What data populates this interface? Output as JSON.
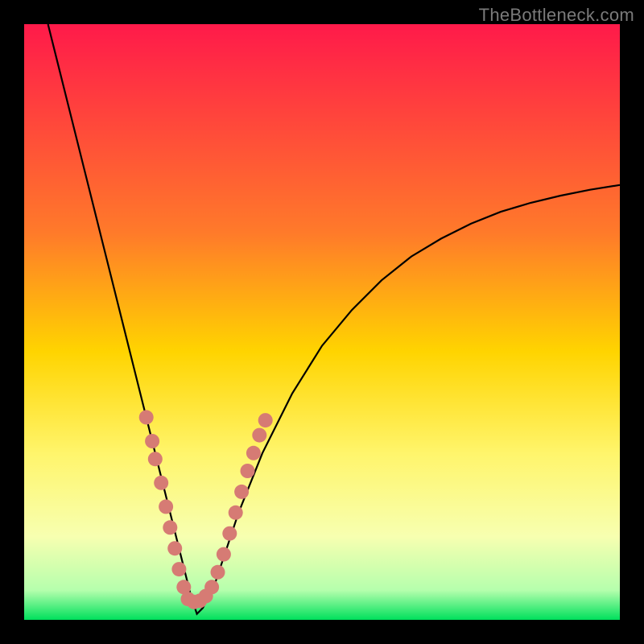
{
  "watermark": "TheBottleneck.com",
  "chart_data": {
    "type": "line",
    "title": "",
    "xlabel": "",
    "ylabel": "",
    "xlim": [
      0,
      100
    ],
    "ylim": [
      0,
      100
    ],
    "gradient_stops": [
      {
        "offset": 0,
        "color": "#ff1a4a"
      },
      {
        "offset": 35,
        "color": "#ff7a2a"
      },
      {
        "offset": 55,
        "color": "#ffd400"
      },
      {
        "offset": 72,
        "color": "#fff56b"
      },
      {
        "offset": 86,
        "color": "#f7ffb0"
      },
      {
        "offset": 95,
        "color": "#b6ffad"
      },
      {
        "offset": 100,
        "color": "#00e05c"
      }
    ],
    "series": [
      {
        "name": "bottleneck-curve",
        "x": [
          4,
          6,
          8,
          10,
          12,
          14,
          16,
          18,
          20,
          22,
          24,
          26,
          27,
          28,
          29,
          30,
          32,
          34,
          36,
          40,
          45,
          50,
          55,
          60,
          65,
          70,
          75,
          80,
          85,
          90,
          95,
          100
        ],
        "values": [
          100,
          92,
          84,
          76,
          68,
          60,
          52,
          44,
          36,
          28,
          20,
          12,
          8,
          4,
          1,
          2,
          6,
          12,
          18,
          28,
          38,
          46,
          52,
          57,
          61,
          64,
          66.5,
          68.5,
          70,
          71.2,
          72.2,
          73
        ]
      }
    ],
    "marker_points": {
      "left_branch": [
        {
          "x": 20.5,
          "y": 34
        },
        {
          "x": 21.5,
          "y": 30
        },
        {
          "x": 22.0,
          "y": 27
        },
        {
          "x": 23.0,
          "y": 23
        },
        {
          "x": 23.8,
          "y": 19
        },
        {
          "x": 24.5,
          "y": 15.5
        },
        {
          "x": 25.3,
          "y": 12
        },
        {
          "x": 26.0,
          "y": 8.5
        },
        {
          "x": 26.8,
          "y": 5.5
        }
      ],
      "bottom": [
        {
          "x": 27.5,
          "y": 3.5
        },
        {
          "x": 28.5,
          "y": 3.0
        },
        {
          "x": 29.5,
          "y": 3.2
        },
        {
          "x": 30.5,
          "y": 4.0
        },
        {
          "x": 31.5,
          "y": 5.5
        }
      ],
      "right_branch": [
        {
          "x": 32.5,
          "y": 8
        },
        {
          "x": 33.5,
          "y": 11
        },
        {
          "x": 34.5,
          "y": 14.5
        },
        {
          "x": 35.5,
          "y": 18
        },
        {
          "x": 36.5,
          "y": 21.5
        },
        {
          "x": 37.5,
          "y": 25
        },
        {
          "x": 38.5,
          "y": 28
        },
        {
          "x": 39.5,
          "y": 31
        },
        {
          "x": 40.5,
          "y": 33.5
        }
      ]
    }
  }
}
